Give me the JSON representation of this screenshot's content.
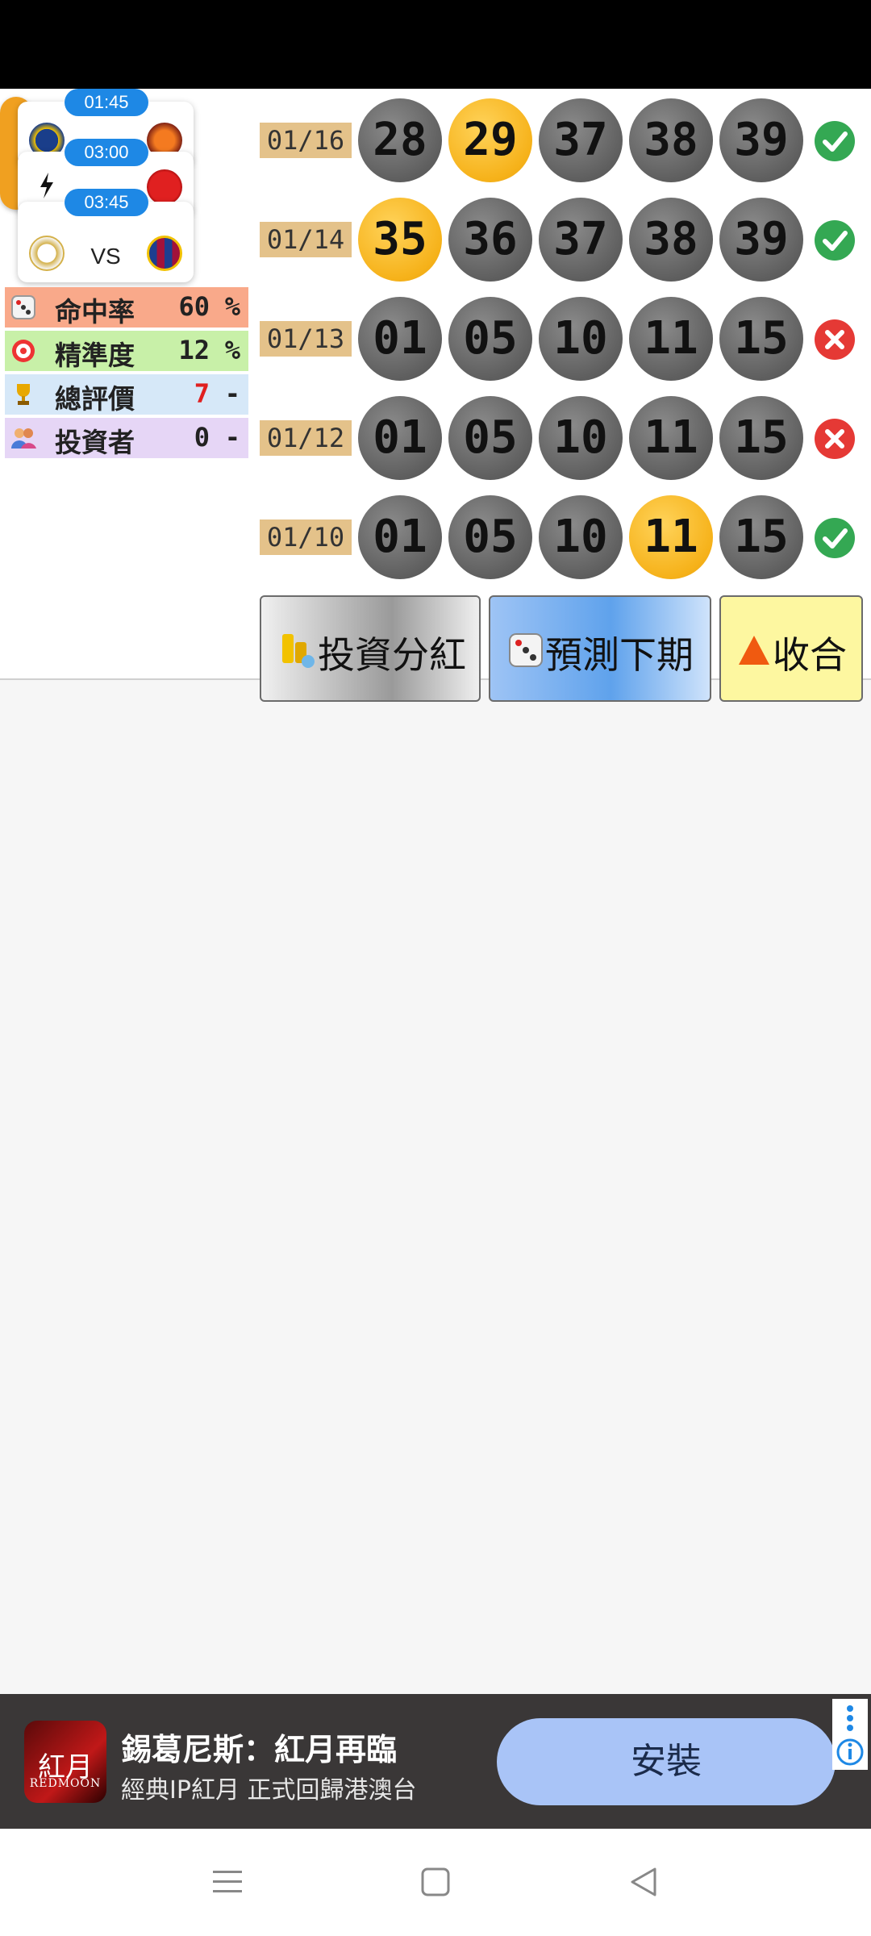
{
  "matches": [
    {
      "time": "01:45",
      "vs": "VS"
    },
    {
      "time": "03:00",
      "vs": "VS"
    },
    {
      "time": "03:45",
      "vs": "VS"
    }
  ],
  "stats": [
    {
      "icon": "dice-icon",
      "label": "命中率",
      "value": "60",
      "unit": "%",
      "bg": "#f9a98a"
    },
    {
      "icon": "target-icon",
      "label": "精準度",
      "value": "12",
      "unit": "%",
      "bg": "#c8f0a8"
    },
    {
      "icon": "trophy-icon",
      "label": "總評價",
      "value": "7",
      "unit": "-",
      "bg": "#d6e8f8",
      "value_color": "#e02020"
    },
    {
      "icon": "users-icon",
      "label": "投資者",
      "value": "0",
      "unit": "-",
      "bg": "#e6d6f6"
    }
  ],
  "draws": [
    {
      "date": "01/16",
      "balls": [
        "28",
        "29",
        "37",
        "38",
        "39"
      ],
      "hits": [
        false,
        true,
        false,
        false,
        false
      ],
      "result": "ok"
    },
    {
      "date": "01/14",
      "balls": [
        "35",
        "36",
        "37",
        "38",
        "39"
      ],
      "hits": [
        true,
        false,
        false,
        false,
        false
      ],
      "result": "ok"
    },
    {
      "date": "01/13",
      "balls": [
        "01",
        "05",
        "10",
        "11",
        "15"
      ],
      "hits": [
        false,
        false,
        false,
        false,
        false
      ],
      "result": "bad"
    },
    {
      "date": "01/12",
      "balls": [
        "01",
        "05",
        "10",
        "11",
        "15"
      ],
      "hits": [
        false,
        false,
        false,
        false,
        false
      ],
      "result": "bad"
    },
    {
      "date": "01/10",
      "balls": [
        "01",
        "05",
        "10",
        "11",
        "15"
      ],
      "hits": [
        false,
        false,
        false,
        true,
        false
      ],
      "result": "ok"
    }
  ],
  "buttons": {
    "invest": "投資分紅",
    "predict": "預測下期",
    "collapse": "收合"
  },
  "ad": {
    "app_icon_text": "紅月",
    "app_icon_sub": "REDMOON",
    "title": "錫葛尼斯：紅月再臨",
    "subtitle": "經典IP紅月 正式回歸港澳台",
    "install": "安裝"
  },
  "colors": {
    "hit": "#f6b21a",
    "miss": "#5f5f5f",
    "ok": "#34a853",
    "bad": "#e53935",
    "date_bg": "#e4c28a"
  }
}
